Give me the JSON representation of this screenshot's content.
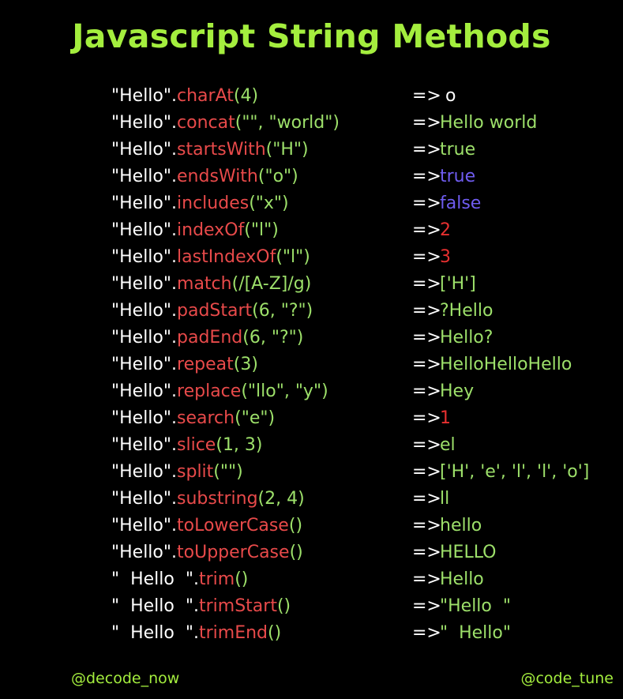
{
  "title": "Javascript String Methods",
  "colors": {
    "background": "#000000",
    "title": "#a4ee3e",
    "string": "#ffffff",
    "method": "#e84a4a",
    "argument": "#9de06a",
    "result_green": "#9de06a",
    "result_red": "#e83030",
    "result_purple": "#6f5cf0",
    "result_white": "#ffffff"
  },
  "rows": [
    {
      "str": "\"Hello\"",
      "method": "charAt",
      "args": "4",
      "arrow": "=>",
      "result": " o",
      "result_color": "#ffffff"
    },
    {
      "str": "\"Hello\"",
      "method": "concat",
      "args": "\"\", \"world\"",
      "arrow": "=>",
      "result": "Hello world",
      "result_color": "#9de06a"
    },
    {
      "str": "\"Hello\"",
      "method": "startsWith",
      "args": "\"H\"",
      "arrow": "=>",
      "result": "true",
      "result_color": "#9de06a"
    },
    {
      "str": "\"Hello\"",
      "method": "endsWith",
      "args": "\"o\"",
      "arrow": "=>",
      "result": "true",
      "result_color": "#6f5cf0"
    },
    {
      "str": "\"Hello\"",
      "method": "includes",
      "args": "\"x\"",
      "arrow": "=>",
      "result": "false",
      "result_color": "#6f5cf0"
    },
    {
      "str": "\"Hello\"",
      "method": "indexOf",
      "args": "\"l\"",
      "arrow": "=>",
      "result": "2",
      "result_color": "#e83030"
    },
    {
      "str": "\"Hello\"",
      "method": "lastIndexOf",
      "args": "\"l\"",
      "arrow": "=>",
      "result": "3",
      "result_color": "#e83030"
    },
    {
      "str": "\"Hello\"",
      "method": "match",
      "args": "/[A-Z]/g",
      "arrow": "=>",
      "result": "['H']",
      "result_color": "#9de06a"
    },
    {
      "str": "\"Hello\"",
      "method": "padStart",
      "args": "6, \"?\"",
      "arrow": "=>",
      "result": "?Hello",
      "result_color": "#9de06a"
    },
    {
      "str": "\"Hello\"",
      "method": "padEnd",
      "args": "6, \"?\"",
      "arrow": "=>",
      "result": "Hello?",
      "result_color": "#9de06a"
    },
    {
      "str": "\"Hello\"",
      "method": "repeat",
      "args": "3",
      "arrow": "=>",
      "result": "HelloHelloHello",
      "result_color": "#9de06a"
    },
    {
      "str": "\"Hello\"",
      "method": "replace",
      "args": "\"llo\", \"y\"",
      "arrow": "=>",
      "result": "Hey",
      "result_color": "#9de06a"
    },
    {
      "str": "\"Hello\"",
      "method": "search",
      "args": "\"e\"",
      "arrow": "=>",
      "result": "1",
      "result_color": "#e83030"
    },
    {
      "str": "\"Hello\"",
      "method": "slice",
      "args": "1, 3",
      "arrow": "=>",
      "result": "el",
      "result_color": "#9de06a"
    },
    {
      "str": "\"Hello\"",
      "method": "split",
      "args": "\"\"",
      "arrow": "=>",
      "result": "['H', 'e', 'l', 'l', 'o']",
      "result_color": "#9de06a"
    },
    {
      "str": "\"Hello\"",
      "method": "substring",
      "args": "2, 4",
      "arrow": "=>",
      "result": "ll",
      "result_color": "#9de06a"
    },
    {
      "str": "\"Hello\"",
      "method": "toLowerCase",
      "args": "",
      "arrow": "=>",
      "result": "hello",
      "result_color": "#9de06a"
    },
    {
      "str": "\"Hello\"",
      "method": "toUpperCase",
      "args": "",
      "arrow": "=>",
      "result": "HELLO",
      "result_color": "#9de06a"
    },
    {
      "str": "\"  Hello  \"",
      "method": "trim",
      "args": "",
      "arrow": "=>",
      "result": "Hello",
      "result_color": "#9de06a"
    },
    {
      "str": "\"  Hello  \"",
      "method": "trimStart",
      "args": "",
      "arrow": "=>",
      "result": "\"Hello  \"",
      "result_color": "#9de06a"
    },
    {
      "str": "\"  Hello  \"",
      "method": "trimEnd",
      "args": "",
      "arrow": "=>",
      "result": "\"  Hello\"",
      "result_color": "#9de06a"
    }
  ],
  "footer": {
    "left_handle": "@decode_now",
    "right_handle": "@code_tune"
  }
}
